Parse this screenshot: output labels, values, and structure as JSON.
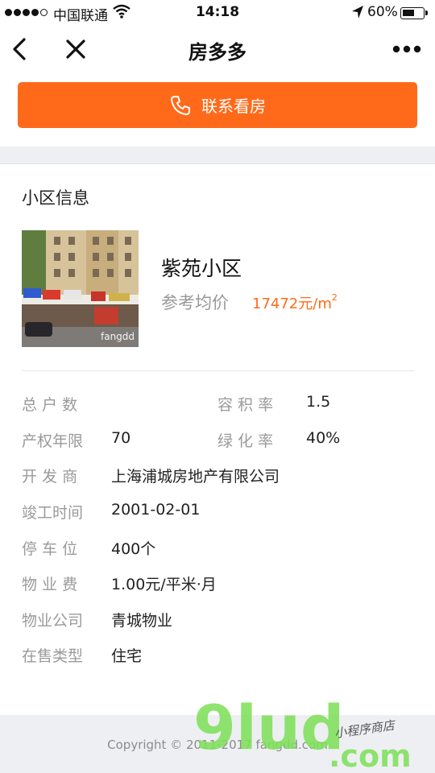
{
  "status_bar": {
    "carrier": "中国联通",
    "time": "14:18",
    "battery": "60%",
    "battery_level": 0.6
  },
  "nav": {
    "title": "房多多",
    "icons": [
      "back-arrow-icon",
      "close-icon",
      "more-dots-icon"
    ]
  },
  "contact_button": {
    "label": "联系看房",
    "icon": "phone-icon"
  },
  "community": {
    "section_title": "小区信息",
    "name": "紫苑小区",
    "price_label": "参考均价",
    "price_value": "17472元/m",
    "price_unit_sup": "2",
    "thumb_caption": "fangdd"
  },
  "details": {
    "total_households_label": "总 户 数",
    "plot_ratio_label": "容 积 率",
    "plot_ratio_value": "1.5",
    "property_years_label": "产权年限",
    "property_years_value": "70",
    "green_ratio_label": "绿 化 率",
    "green_ratio_value": "40%",
    "developer_label": "开 发 商",
    "developer_value": "上海浦城房地产有限公司",
    "completion_label": "竣工时间",
    "completion_value": "2001-02-01",
    "parking_label": "停 车 位",
    "parking_value": "400个",
    "fee_label": "物 业 费",
    "fee_value": "1.00元/平米·月",
    "management_label": "物业公司",
    "management_value": "青城物业",
    "sale_type_label": "在售类型",
    "sale_type_value": "住宅"
  },
  "footer": {
    "copyright": "Copyright © 2011-2017 fangdd.com"
  },
  "watermark": {
    "text": "9lud",
    "suffix": ".com",
    "tagline": "小程序商店",
    "color": "#7ee05a"
  }
}
